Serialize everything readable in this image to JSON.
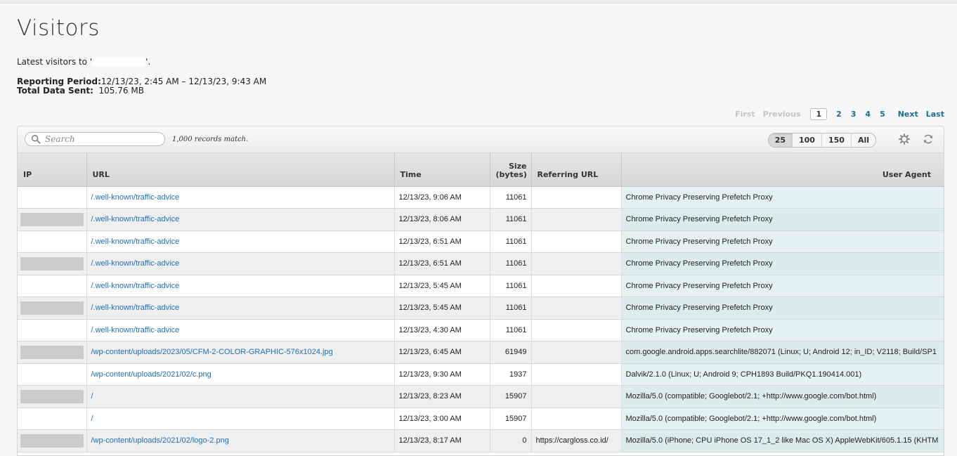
{
  "page": {
    "title": "Visitors",
    "subtitle_prefix": "Latest visitors to '",
    "subtitle_suffix": "'.",
    "period_label": "Reporting Period:",
    "period_value": "12/13/23, 2:45 AM  –  12/13/23, 9:43 AM",
    "data_label": "Total Data Sent:",
    "data_value": "105.76 MB"
  },
  "pagination": {
    "first": "First",
    "previous": "Previous",
    "pages": [
      "1",
      "2",
      "3",
      "4",
      "5"
    ],
    "current": "1",
    "next": "Next",
    "last": "Last"
  },
  "toolbar": {
    "search_placeholder": "Search",
    "matches": "1,000 records match.",
    "page_sizes": [
      "25",
      "100",
      "150",
      "All"
    ],
    "active_size": "25",
    "icons": [
      "search-icon",
      "gear-icon",
      "refresh-icon"
    ]
  },
  "table": {
    "columns": [
      "IP",
      "URL",
      "Time",
      "Size (bytes)",
      "Referring URL",
      "User Agent"
    ],
    "rows": [
      {
        "ip_redacted": false,
        "url": "/.well-known/traffic-advice",
        "time": "12/13/23, 9:06 AM",
        "size": "11061",
        "ref": "",
        "ua": "Chrome Privacy Preserving Prefetch Proxy"
      },
      {
        "ip_redacted": true,
        "url": "/.well-known/traffic-advice",
        "time": "12/13/23, 8:06 AM",
        "size": "11061",
        "ref": "",
        "ua": "Chrome Privacy Preserving Prefetch Proxy"
      },
      {
        "ip_redacted": false,
        "url": "/.well-known/traffic-advice",
        "time": "12/13/23, 6:51 AM",
        "size": "11061",
        "ref": "",
        "ua": "Chrome Privacy Preserving Prefetch Proxy"
      },
      {
        "ip_redacted": true,
        "url": "/.well-known/traffic-advice",
        "time": "12/13/23, 6:51 AM",
        "size": "11061",
        "ref": "",
        "ua": "Chrome Privacy Preserving Prefetch Proxy"
      },
      {
        "ip_redacted": false,
        "url": "/.well-known/traffic-advice",
        "time": "12/13/23, 5:45 AM",
        "size": "11061",
        "ref": "",
        "ua": "Chrome Privacy Preserving Prefetch Proxy"
      },
      {
        "ip_redacted": true,
        "url": "/.well-known/traffic-advice",
        "time": "12/13/23, 5:45 AM",
        "size": "11061",
        "ref": "",
        "ua": "Chrome Privacy Preserving Prefetch Proxy"
      },
      {
        "ip_redacted": false,
        "url": "/.well-known/traffic-advice",
        "time": "12/13/23, 4:30 AM",
        "size": "11061",
        "ref": "",
        "ua": "Chrome Privacy Preserving Prefetch Proxy"
      },
      {
        "ip_redacted": true,
        "url": "/wp-content/uploads/2023/05/CFM-2-COLOR-GRAPHIC-576x1024.jpg",
        "time": "12/13/23, 6:45 AM",
        "size": "61949",
        "ref": "",
        "ua": "com.google.android.apps.searchlite/882071 (Linux; U; Android 12; in_ID; V2118; Build/SP1"
      },
      {
        "ip_redacted": false,
        "url": "/wp-content/uploads/2021/02/c.png",
        "time": "12/13/23, 9:30 AM",
        "size": "1937",
        "ref": "",
        "ua": "Dalvik/2.1.0 (Linux; U; Android 9; CPH1893 Build/PKQ1.190414.001)"
      },
      {
        "ip_redacted": true,
        "url": "/",
        "time": "12/13/23, 8:23 AM",
        "size": "15907",
        "ref": "",
        "ua": "Mozilla/5.0 (compatible; Googlebot/2.1; +http://www.google.com/bot.html)"
      },
      {
        "ip_redacted": false,
        "url": "/",
        "time": "12/13/23, 3:00 AM",
        "size": "15907",
        "ref": "",
        "ua": "Mozilla/5.0 (compatible; Googlebot/2.1; +http://www.google.com/bot.html)"
      },
      {
        "ip_redacted": true,
        "url": "/wp-content/uploads/2021/02/logo-2.png",
        "time": "12/13/23, 8:17 AM",
        "size": "0",
        "ref": "https://cargloss.co.id/",
        "ua": "Mozilla/5.0 (iPhone; CPU iPhone OS 17_1_2 like Mac OS X) AppleWebKit/605.1.15 (KHTM"
      }
    ]
  }
}
